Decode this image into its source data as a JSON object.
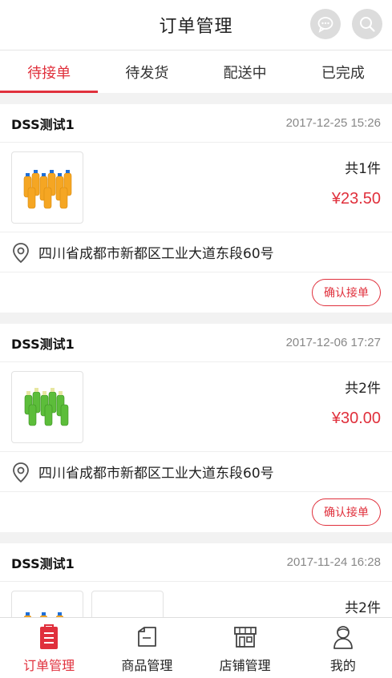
{
  "header": {
    "title": "订单管理"
  },
  "tabs": [
    {
      "label": "待接单",
      "active": true
    },
    {
      "label": "待发货",
      "active": false
    },
    {
      "label": "配送中",
      "active": false
    },
    {
      "label": "已完成",
      "active": false
    }
  ],
  "orders": [
    {
      "shop": "DSS测试1",
      "time": "2017-12-25 15:26",
      "count": "共1件",
      "price": "¥23.50",
      "address": "四川省成都市新都区工业大道东段60号",
      "action": "确认接单",
      "product_icon": "orange-drink-icon"
    },
    {
      "shop": "DSS测试1",
      "time": "2017-12-06 17:27",
      "count": "共2件",
      "price": "¥30.00",
      "address": "四川省成都市新都区工业大道东段60号",
      "action": "确认接单",
      "product_icon": "green-drink-icon"
    },
    {
      "shop": "DSS测试1",
      "time": "2017-11-24 16:28",
      "count": "共2件"
    }
  ],
  "nav": [
    {
      "label": "订单管理",
      "icon": "order-icon",
      "active": true
    },
    {
      "label": "商品管理",
      "icon": "product-icon",
      "active": false
    },
    {
      "label": "店铺管理",
      "icon": "store-icon",
      "active": false
    },
    {
      "label": "我的",
      "icon": "user-icon",
      "active": false
    }
  ],
  "colors": {
    "accent": "#e0303c",
    "background": "#f2f2f2"
  }
}
